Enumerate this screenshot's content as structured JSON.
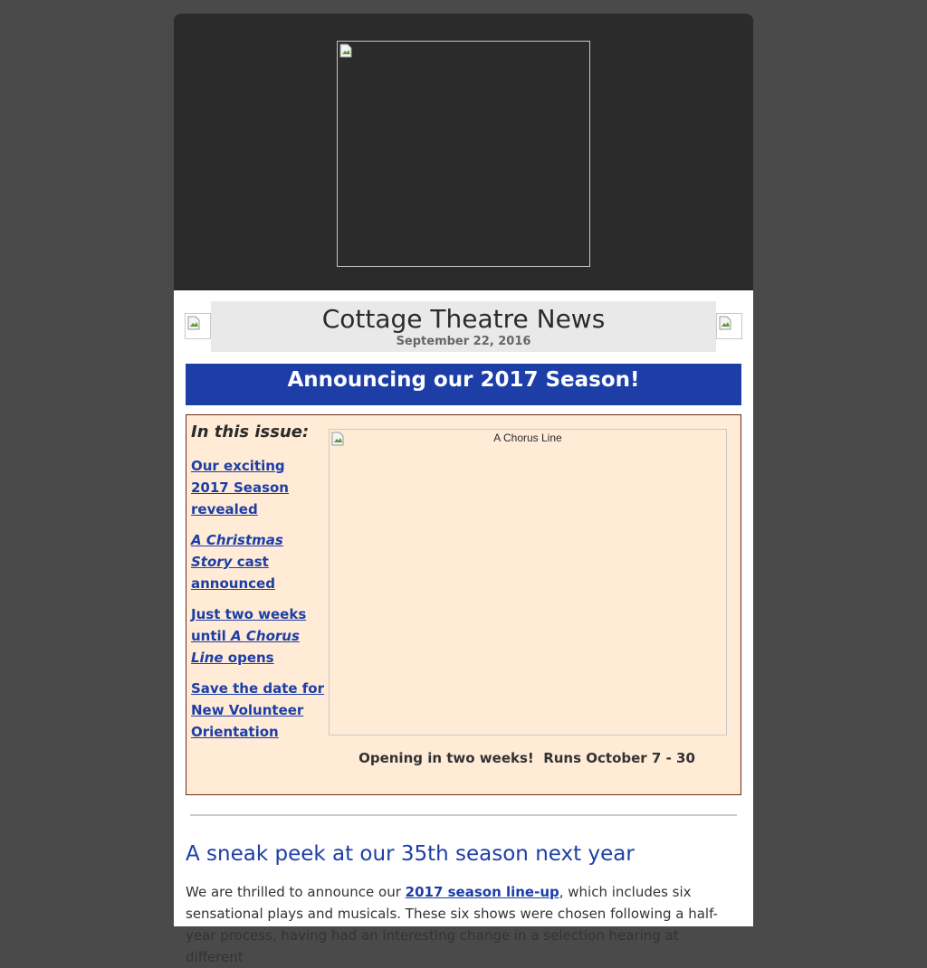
{
  "header": {
    "logo_alt": ""
  },
  "newsletter": {
    "title": "Cottage Theatre News",
    "date": "September 22, 2016"
  },
  "announcement": {
    "text": "Announcing our 2017 Season!"
  },
  "in_this_issue": {
    "heading": "In this issue:",
    "links": [
      {
        "parts": [
          "Our exciting 2017 Season revealed"
        ]
      },
      {
        "italic": "A Christmas Story",
        "rest": " cast announced"
      },
      {
        "pre": "Just two weeks until ",
        "italic": "A Chorus Line",
        "post": " opens"
      },
      {
        "parts": [
          "Save the date for New Volunteer Orientation"
        ]
      }
    ]
  },
  "feature_image": {
    "alt": "A Chorus Line",
    "caption": "Opening in two weeks!  Runs October 7 - 30"
  },
  "section": {
    "heading": "A sneak peek at our 35th season next year",
    "body_pre": "We are thrilled to announce our ",
    "body_link": "2017 season line-up",
    "body_post": ", which includes six sensational plays and musicals. These six shows were chosen following a half-year process, having had an interesting change in a selection hearing at different"
  },
  "colors": {
    "page_bg": "#4a4a4a",
    "header_bg": "#2b2b2b",
    "accent_blue": "#1c3ea6",
    "issue_bg": "#ffebd6",
    "issue_border": "#6b2a18"
  }
}
